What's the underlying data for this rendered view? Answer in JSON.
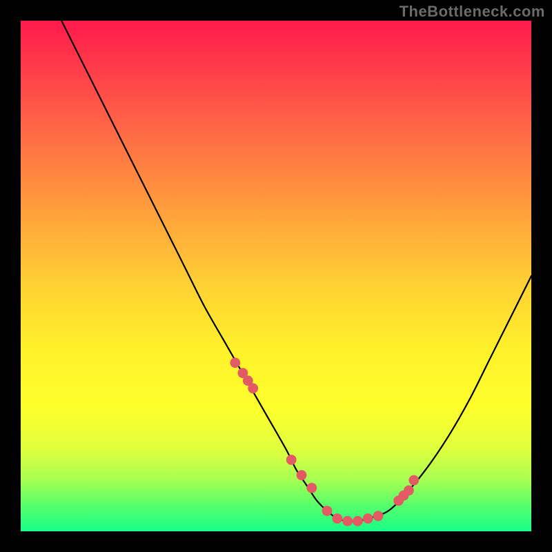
{
  "watermark": "TheBottleneck.com",
  "chart_data": {
    "type": "line",
    "title": "",
    "xlabel": "",
    "ylabel": "",
    "xlim": [
      0,
      100
    ],
    "ylim": [
      0,
      100
    ],
    "grid": false,
    "legend": false,
    "series": [
      {
        "name": "bottleneck-curve",
        "stroke": "#000000",
        "x": [
          8,
          12,
          16,
          20,
          24,
          28,
          32,
          36,
          40,
          44,
          48,
          52,
          54,
          56,
          58,
          60,
          62,
          64,
          66,
          68,
          72,
          76,
          80,
          84,
          88,
          92,
          96,
          100
        ],
        "y": [
          100,
          92,
          84,
          76,
          68,
          60,
          52,
          44,
          37,
          30,
          23,
          16,
          12,
          9,
          6,
          4,
          2.5,
          2,
          2,
          2.5,
          4,
          8,
          13,
          19,
          26,
          34,
          42,
          50
        ]
      }
    ],
    "markers": {
      "name": "highlight-dots",
      "color": "#e15a64",
      "radius_pct": 1.0,
      "x": [
        42,
        43.5,
        44.5,
        45.5,
        53,
        55,
        57,
        60,
        62,
        64,
        66,
        68,
        70,
        74,
        75,
        76,
        77
      ],
      "y": [
        33,
        31,
        29.5,
        28,
        14,
        11,
        8.5,
        4,
        2.5,
        2,
        2,
        2.5,
        3,
        6,
        7,
        8,
        10
      ]
    },
    "background_gradient": {
      "top": "#ff1a4b",
      "mid": "#fff22a",
      "bottom": "#18ff88"
    }
  }
}
